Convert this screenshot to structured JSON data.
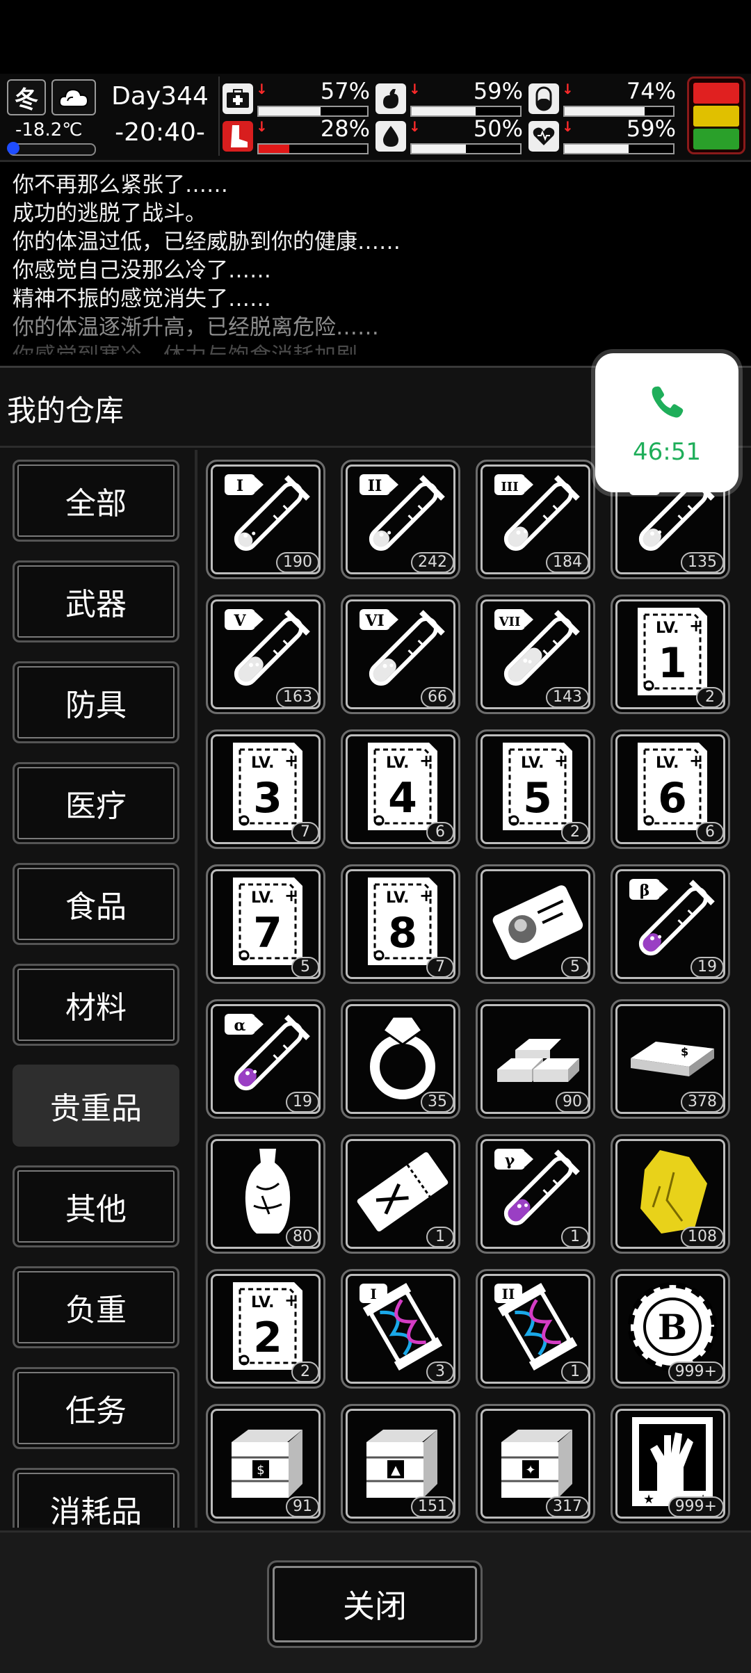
{
  "status": {
    "season": "冬",
    "weather_icon": "cloud-icon",
    "temperature": "-18.2℃",
    "day": "Day344",
    "time": "-20:40-",
    "stats": [
      {
        "name": "health",
        "icon": "medkit-icon",
        "percent": "57%",
        "value": 57,
        "bar_color": "white"
      },
      {
        "name": "hunger",
        "icon": "stomach-icon",
        "percent": "59%",
        "value": 59,
        "bar_color": "white"
      },
      {
        "name": "mood",
        "icon": "pill-icon",
        "percent": "74%",
        "value": 74,
        "bar_color": "white"
      },
      {
        "name": "stamina",
        "icon": "leg-icon",
        "percent": "28%",
        "value": 28,
        "bar_color": "red"
      },
      {
        "name": "thirst",
        "icon": "water-drop-icon",
        "percent": "50%",
        "value": 50,
        "bar_color": "white"
      },
      {
        "name": "spirit",
        "icon": "heart-icon",
        "percent": "59%",
        "value": 59,
        "bar_color": "white"
      }
    ],
    "alert_colors": [
      "#e02020",
      "#e0c000",
      "#2aa02a"
    ]
  },
  "log": [
    "你不再那么紧张了……",
    "成功的逃脱了战斗。",
    "你的体温过低，已经威胁到你的健康……",
    "你感觉自己没那么冷了……",
    "精神不振的感觉消失了……",
    "你的体温逐渐升高，已经脱离危险……",
    "你感觉到寒冷，体力与饱食消耗加剧"
  ],
  "warehouse": {
    "title": "我的仓库",
    "categories": [
      "全部",
      "武器",
      "防具",
      "医疗",
      "食品",
      "材料",
      "贵重品",
      "其他",
      "负重",
      "任务",
      "消耗品"
    ],
    "active_category": "贵重品",
    "items": [
      {
        "icon": "serum-tube-I-icon",
        "count": "190"
      },
      {
        "icon": "serum-tube-II-icon",
        "count": "242"
      },
      {
        "icon": "serum-tube-III-icon",
        "count": "184"
      },
      {
        "icon": "serum-tube-IV-icon",
        "count": "135"
      },
      {
        "icon": "serum-tube-V-icon",
        "count": "163"
      },
      {
        "icon": "serum-tube-VI-icon",
        "count": "66"
      },
      {
        "icon": "serum-tube-VII-icon",
        "count": "143"
      },
      {
        "icon": "lv1-card-icon",
        "count": "2"
      },
      {
        "icon": "lv3-card-icon",
        "count": "7"
      },
      {
        "icon": "lv4-card-icon",
        "count": "6"
      },
      {
        "icon": "lv5-card-icon",
        "count": "2"
      },
      {
        "icon": "lv6-card-icon",
        "count": "6"
      },
      {
        "icon": "lv7-card-icon",
        "count": "5"
      },
      {
        "icon": "lv8-card-icon",
        "count": "7"
      },
      {
        "icon": "id-card-icon",
        "count": "5"
      },
      {
        "icon": "beta-serum-tube-icon",
        "count": "19"
      },
      {
        "icon": "alpha-serum-tube-icon",
        "count": "19"
      },
      {
        "icon": "diamond-ring-icon",
        "count": "35"
      },
      {
        "icon": "gold-bars-icon",
        "count": "90"
      },
      {
        "icon": "cash-stack-icon",
        "count": "378"
      },
      {
        "icon": "porcelain-vase-icon",
        "count": "80"
      },
      {
        "icon": "ticket-icon",
        "count": "1"
      },
      {
        "icon": "gamma-serum-tube-icon",
        "count": "1"
      },
      {
        "icon": "gold-ore-icon",
        "count": "108"
      },
      {
        "icon": "lv2-card-icon",
        "count": "2"
      },
      {
        "icon": "dna-capsule-I-icon",
        "count": "3"
      },
      {
        "icon": "dna-capsule-II-icon",
        "count": "1"
      },
      {
        "icon": "bitcoin-chip-icon",
        "count": "999+"
      },
      {
        "icon": "supply-crate-cash-icon",
        "count": "91"
      },
      {
        "icon": "supply-crate-fire-icon",
        "count": "151"
      },
      {
        "icon": "supply-crate-explosive-icon",
        "count": "317"
      },
      {
        "icon": "zombie-card-icon",
        "count": "999+"
      }
    ],
    "close_label": "关闭"
  },
  "call_bubble": {
    "icon": "phone-icon",
    "time": "46:51"
  }
}
